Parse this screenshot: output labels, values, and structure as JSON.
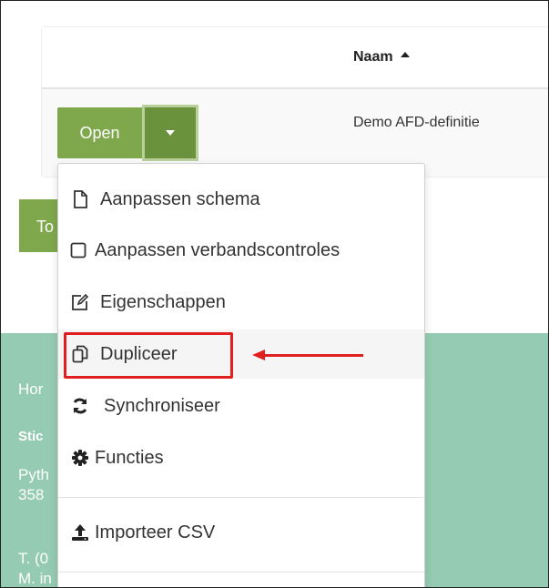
{
  "table": {
    "header": {
      "naam": "Naam"
    },
    "rows": [
      {
        "name": "Demo AFD-definitie"
      }
    ]
  },
  "split_button": {
    "open_label": "Open"
  },
  "background_button": {
    "label_partial": "To"
  },
  "footer": {
    "line1": "Hor",
    "line2": "Stic",
    "line3": "Pyth",
    "line4": "358",
    "line5": "T. (0",
    "line6": "M. in"
  },
  "dropdown": {
    "items": [
      {
        "label": "Aanpassen schema",
        "icon": "file-icon"
      },
      {
        "label": "Aanpassen verbandscontroles",
        "icon": "square-icon"
      },
      {
        "label": "Eigenschappen",
        "icon": "edit-icon"
      },
      {
        "label": "Dupliceer",
        "icon": "copy-icon"
      },
      {
        "label": "Synchroniseer",
        "icon": "sync-icon"
      },
      {
        "label": "Functies",
        "icon": "gear-icon"
      },
      {
        "label": "Importeer CSV",
        "icon": "upload-icon"
      }
    ]
  },
  "colors": {
    "button_green": "#7fa84c",
    "button_green_dark": "#6a913c",
    "footer_teal": "#95cbb3",
    "annotation_red": "#e02020"
  }
}
